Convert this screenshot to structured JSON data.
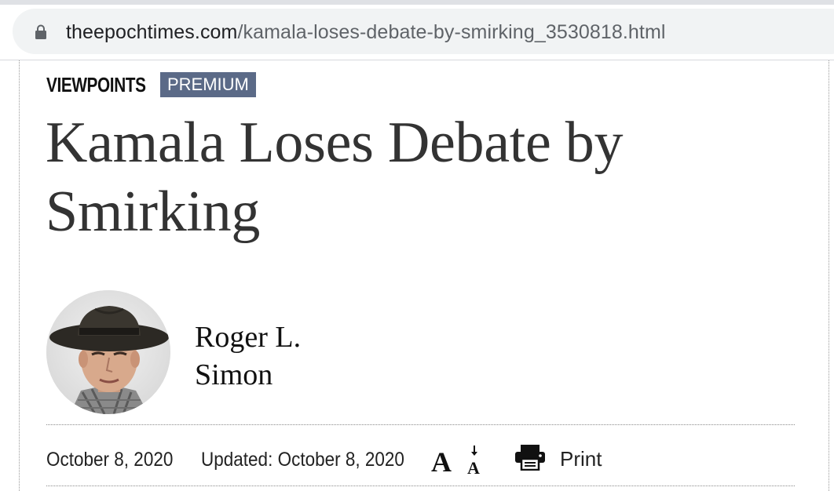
{
  "browser": {
    "url_domain": "theepochtimes.com",
    "url_path": "/kamala-loses-debate-by-smirking_3530818.html",
    "lock_icon": "lock-icon"
  },
  "article": {
    "section": "VIEWPOINTS",
    "badge": "PREMIUM",
    "title": "Kamala Loses Debate by Smirking",
    "author": {
      "name": "Roger L. Simon",
      "avatar_icon": "author-photo"
    },
    "published": "October 8, 2020",
    "updated": "Updated: October 8, 2020",
    "font_size_icon": "font-size-icon",
    "print_label": "Print",
    "print_icon": "printer-icon"
  },
  "colors": {
    "badge_bg": "#5b6a87",
    "headline": "#333333",
    "url_bar_bg": "#f1f3f4"
  }
}
